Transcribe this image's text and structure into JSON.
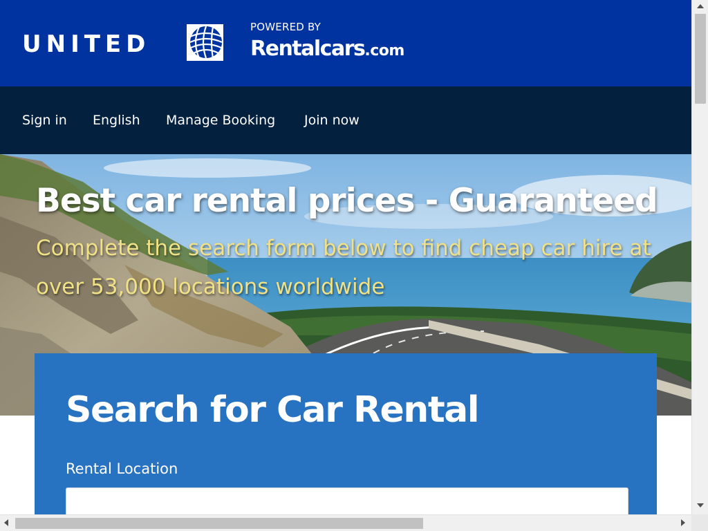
{
  "header": {
    "brand_name": "UNITED",
    "powered_by": "POWERED BY",
    "partner_name": "Rentalcars",
    "partner_suffix": ".com",
    "brand_color": "#0033a0",
    "nav_color": "#03203f"
  },
  "nav": {
    "items": [
      {
        "label": "Sign in"
      },
      {
        "label": "English"
      },
      {
        "label": "Manage Booking"
      },
      {
        "label": "Join now"
      }
    ]
  },
  "hero": {
    "title": "Best car rental prices - Guaranteed",
    "subtitle": "Complete the search form below to find cheap car hire at over 53,000 locations worldwide",
    "subtitle_color": "#f0e186"
  },
  "search": {
    "heading": "Search for Car Rental",
    "location_label": "Rental Location",
    "location_value": "",
    "panel_color": "#2872c2"
  },
  "icons": {
    "globe": "united-globe-icon",
    "scroll_up": "arrow-up-icon",
    "scroll_down": "arrow-down-icon",
    "scroll_left": "arrow-left-icon",
    "scroll_right": "arrow-right-icon"
  }
}
